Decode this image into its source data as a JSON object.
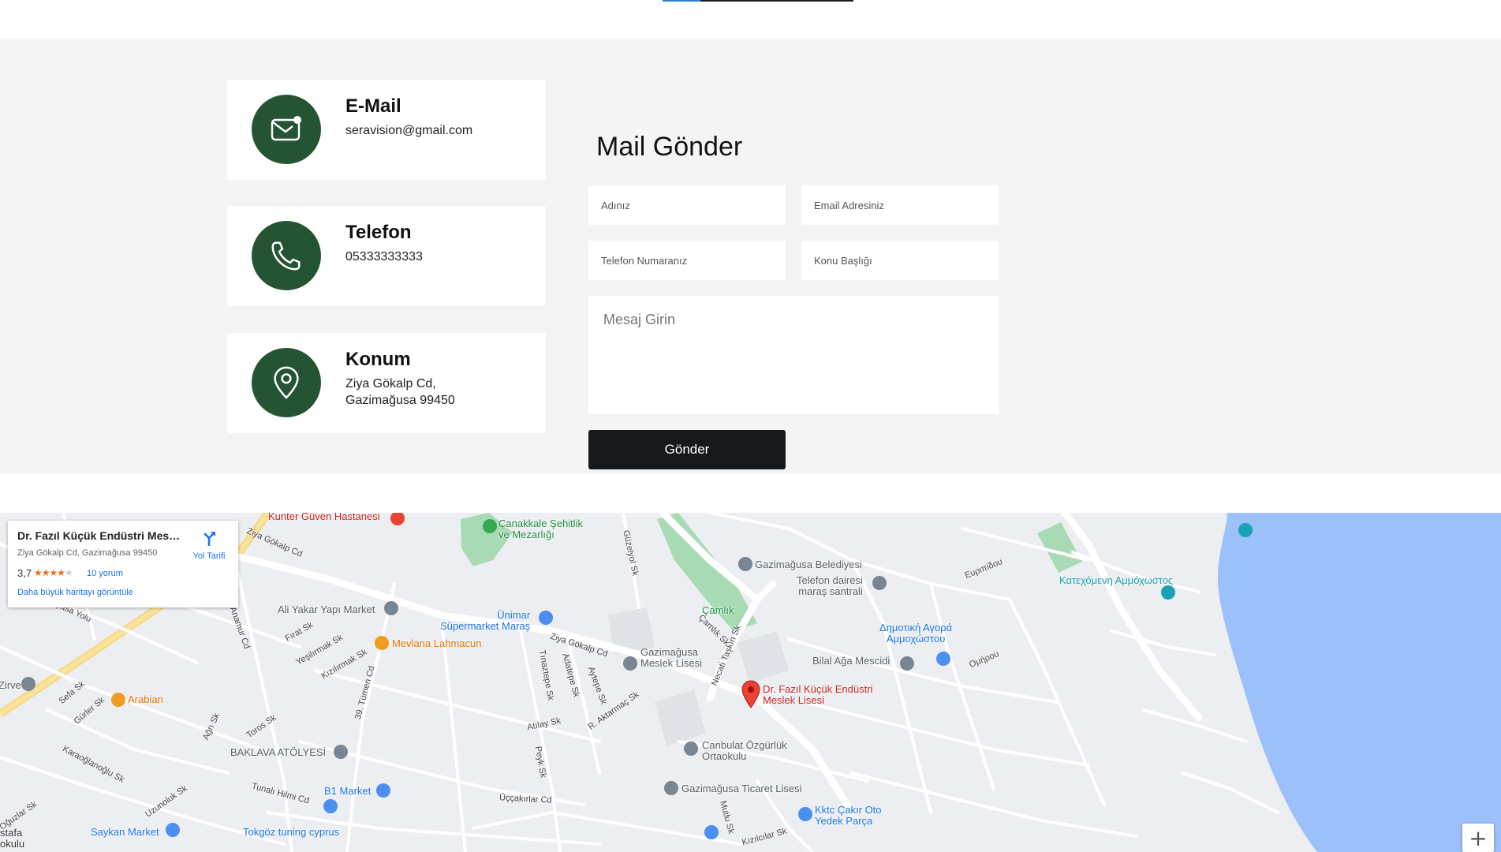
{
  "contact": {
    "email": {
      "title": "E-Mail",
      "value": "seravision@gmail.com",
      "icon": "mail-icon"
    },
    "phone": {
      "title": "Telefon",
      "value": "05333333333",
      "icon": "phone-icon"
    },
    "location": {
      "title": "Konum",
      "line1": "Ziya Gökalp Cd,",
      "line2": "Gazimağusa 99450",
      "icon": "map-pin-icon"
    },
    "icon_bg_color": "#255434"
  },
  "form": {
    "title": "Mail Gönder",
    "name_placeholder": "Adınız",
    "email_placeholder": "Email Adresiniz",
    "phone_placeholder": "Telefon Numaranız",
    "subject_placeholder": "Konu Başlığı",
    "message_placeholder": "Mesaj Girin",
    "submit_label": "Gönder",
    "submit_color": "#15191c"
  },
  "map": {
    "place_card": {
      "name": "Dr. Fazıl Küçük Endüstri Mesleki Lisesi",
      "address": "Ziya Gökalp Cd, Gazimağusa 99450",
      "rating": "3,7",
      "reviews": "10 yorum",
      "directions": "Yol Tarifi",
      "larger_map": "Daha büyük haritayı görüntüle"
    },
    "labels": {
      "kunter": "Kunter Güven Hastanesi",
      "canakkale": "Çanakkale Şehitlik\nve Mezarlığı",
      "belediye": "Gazimağusa Belediyesi",
      "telefon_dairesi": "Telefon dairesi\nmaraş santrali",
      "katexomeni": "Κατεχόμενη Αμμόχωστος",
      "ali_yakar": "Ali Yakar Yapı Market",
      "unimar": "Ünimar\nSüpermarket Maraş",
      "camlik": "Çamlık",
      "dimotiki": "Δημοτική Αγορά\nΑμμοχώστου",
      "mevlana": "Mevlana Lahmacun",
      "gazimagusa_lisesi": "Gazimağusa\nMeslek Lisesi",
      "bilal_aga": "Bilal Ağa Mescidi",
      "selected": "Dr. Fazıl Küçük Endüstri\nMeslek Lisesi",
      "arabian": "Arabian",
      "zirve": "Zirve",
      "baklava": "BAKLAVA ATÖLYESİ",
      "canbulat": "Canbulat Özgürlük\nOrtaokulu",
      "b1_market": "B1 Market",
      "ticaret": "Gazimağusa Ticaret Lisesi",
      "kktc": "Kktc Çakır Oto\nYedek Parça",
      "saykan": "Saykan Market",
      "tokgoz": "Tokgöz tuning cyprus",
      "stafa": "stafa\nokulu"
    },
    "streets": {
      "ziya_gokalp_1": "Ziya Gökalp Cd",
      "ziya_gokalp_2": "Ziya Gökalp Cd",
      "euripidou": "Ευριπίδου",
      "omirou": "Ομήρου",
      "firat": "Fırat Sk",
      "yesilirmak": "Yeşilırmak Sk",
      "kizilirmak": "Kızılırmak Sk",
      "tumen": "39. Tümen Cd",
      "sefa": "Sefa Sk",
      "gurler": "Gürler Sk",
      "agri": "Ağrı Sk",
      "toros": "Toros Sk",
      "karaoglanoglu": "Karaoğlanoğlu Sk",
      "tunali": "Tunalı Hilmi Cd",
      "uzunoluk": "Uzunoluk Sk",
      "oguzlar": "Oğuzlar Sk",
      "uccakirlar": "Üççakırlar Cd",
      "peyk": "Peyk Sk",
      "atilay": "Atılay Sk",
      "aktarmac": "R. Aktarmaç Sk",
      "tinaztepe": "Tınaztepe Sk",
      "adatepe": "Adatepe Sk",
      "aytepe": "Aytepe Sk",
      "necati": "Necati Taşkın Sk",
      "camlik_sk": "Çamlık Sk",
      "guzelyol": "Güzelyol Sk",
      "anamur": "Anamur Cd",
      "yasa_yolu": "yasa Yolu",
      "mutlu": "Mutlu Sk",
      "kizilcilar": "Kızılcılar Sk"
    },
    "zoom_in": "+",
    "sea_color": "#9cc0f9",
    "park_color": "#a8dab5",
    "pin_color": "#ea4335"
  }
}
